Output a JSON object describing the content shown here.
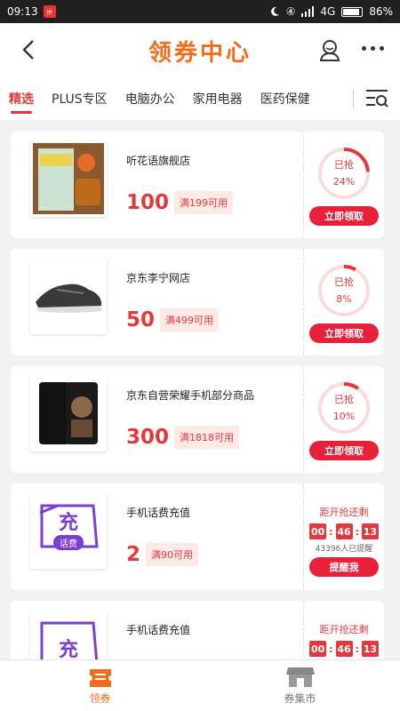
{
  "status": {
    "time": "09:13",
    "app_badge": "拼",
    "ring_mark": "④",
    "signal": "4G",
    "battery": "86%"
  },
  "header": {
    "title": "领券中心"
  },
  "tabs": [
    "精选",
    "PLUS专区",
    "电脑办公",
    "家用电器",
    "医药保健"
  ],
  "coupons": [
    {
      "shop": "听花语旗舰店",
      "amount": "100",
      "cond": "满199可用",
      "claimed": "已抢",
      "percent": "24%",
      "pct": 0.24,
      "btn": "立即领取"
    },
    {
      "shop": "京东李宁网店",
      "amount": "50",
      "cond": "满499可用",
      "claimed": "已抢",
      "percent": "8%",
      "pct": 0.08,
      "btn": "立即领取"
    },
    {
      "shop": "京东自营荣耀手机部分商品",
      "amount": "300",
      "cond": "满1818可用",
      "claimed": "已抢",
      "percent": "10%",
      "pct": 0.1,
      "btn": "立即领取"
    },
    {
      "shop": "手机话费充值",
      "amount": "2",
      "cond": "满90可用",
      "countdown_label": "距开抢还剩",
      "hh": "00",
      "mm": "46",
      "ss": "13",
      "reminded": "43396人已提醒",
      "btn": "提醒我"
    },
    {
      "shop": "手机话费充值",
      "countdown_label": "距开抢还剩",
      "hh": "00",
      "mm": "46",
      "ss": "13"
    }
  ],
  "charge_badge": {
    "big": "充",
    "small": "话费"
  },
  "bottom_nav": [
    {
      "label": "领券"
    },
    {
      "label": "券集市"
    }
  ],
  "colors": {
    "accent": "#e4393c",
    "brand_orange": "#f26c1c"
  }
}
